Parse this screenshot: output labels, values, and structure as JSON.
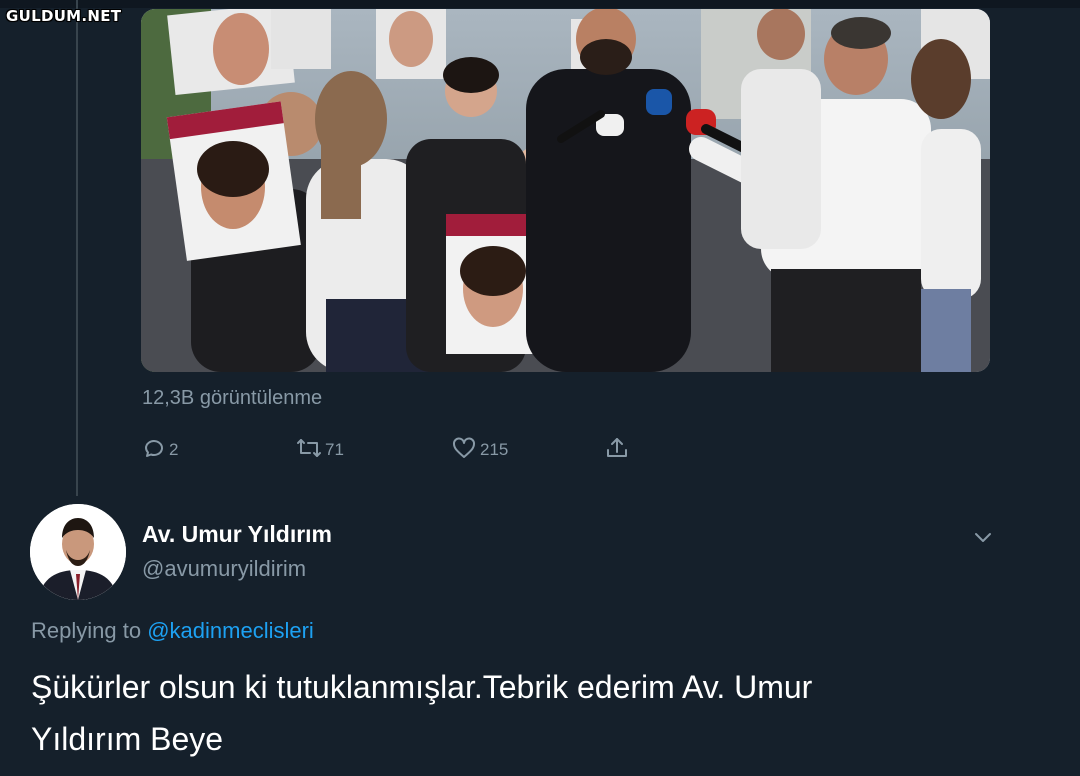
{
  "watermark": "GULDUM.NET",
  "quoted_tweet": {
    "views": "12,3B görüntülenme",
    "stats": {
      "replies": "2",
      "retweets": "71",
      "likes": "215"
    }
  },
  "reply_tweet": {
    "display_name": "Av. Umur Yıldırım",
    "handle": "@avumuryildirim",
    "replying_prefix": "Replying to",
    "replying_mention": "@kadinmeclisleri",
    "text_line1": "Şükürler olsun ki tutuklanmışlar.Tebrik ederim Av. Umur",
    "text_line2": "Yıldırım Beye"
  },
  "icons": {
    "reply": "reply-icon",
    "retweet": "retweet-icon",
    "like": "heart-icon",
    "share": "share-icon",
    "more": "chevron-down-icon"
  },
  "colors": {
    "background": "#15202b",
    "secondary_text": "#8899a6",
    "link": "#1da1f2",
    "primary_text": "#ffffff"
  }
}
